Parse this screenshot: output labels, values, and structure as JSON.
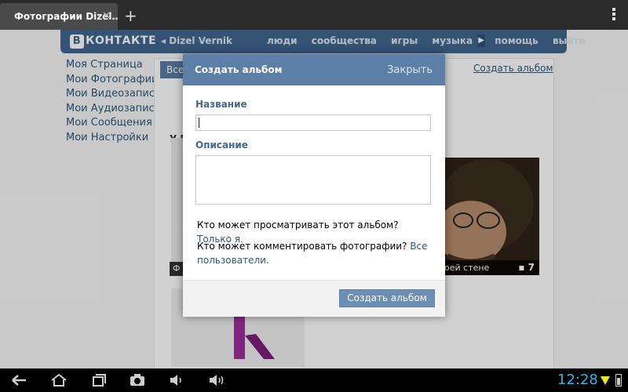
{
  "browser": {
    "tab_title": "Фотографии Dizel…",
    "close_glyph": "✕",
    "new_tab_glyph": "+"
  },
  "vk": {
    "logo_letter": "В",
    "logo_text": "КОНТАКТЕ",
    "user_name": "Dizel Vernik",
    "nav": [
      "люди",
      "сообщества",
      "игры",
      "музыка",
      "помощь",
      "выйти"
    ],
    "nav_arrow": "▶",
    "sidebar": [
      "Моя Страница",
      "Мои Фотографии",
      "Мои Видеозаписи",
      "Мои Аудиозаписи",
      "Мои Сообщения",
      "Мои Настройки"
    ],
    "tab_all": "Все",
    "create_album_link": "Создать альбом",
    "section_label": "У В",
    "album1_caption": "Ф",
    "album2_caption": "оей стене",
    "album2_count": "7",
    "album2_count_icon": "camera-icon"
  },
  "modal": {
    "title": "Создать альбом",
    "close_label": "Закрыть",
    "name_label": "Название",
    "name_value": "",
    "description_label": "Описание",
    "description_value": "",
    "view_question": "Кто может просматривать этот альбом?",
    "view_value": "Только я.",
    "comment_question": "Кто может комментировать фотографии?",
    "comment_value": "Все пользователи.",
    "submit_label": "Создать альбом"
  },
  "system_bar": {
    "time": "12:28",
    "icons": [
      "back-icon",
      "home-icon",
      "recent-apps-icon",
      "camera-icon",
      "volume-down-icon",
      "volume-up-icon",
      "signal-icon",
      "battery-icon"
    ]
  },
  "colors": {
    "vk_blue": "#40668f",
    "modal_header": "#5b7fa6",
    "link": "#2b587a",
    "clock": "#33b5e5"
  }
}
